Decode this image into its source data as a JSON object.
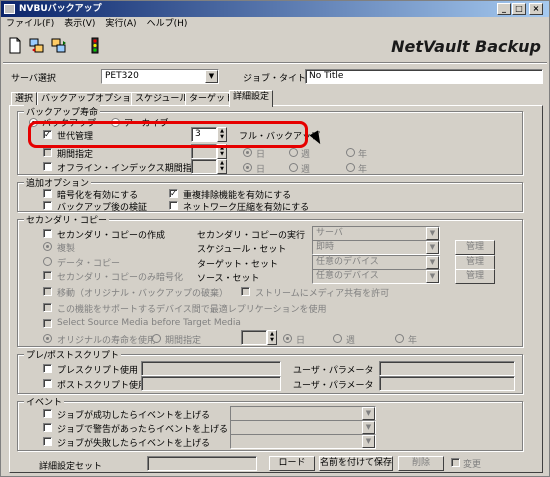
{
  "window": {
    "title": "NVBUバックアップ",
    "min": "_",
    "max": "□",
    "close": "×"
  },
  "menu": [
    "ファイル(F)",
    "表示(V)",
    "実行(A)",
    "ヘルプ(H)"
  ],
  "brand": "NetVault Backup",
  "server": {
    "label": "サーバ選択",
    "value": "PET320"
  },
  "job": {
    "label": "ジョブ・タイトル",
    "value": "No Title"
  },
  "tabs": [
    "選択",
    "バックアップオプション",
    "スケジュール",
    "ターゲット",
    "詳細設定"
  ],
  "retention": {
    "title": "バックアップ寿命",
    "radio_backup": "バックアップ",
    "radio_archive": "アーカイブ",
    "generation_label": "世代管理",
    "generation_value": "3",
    "generation_unit": "フル・バックアップ",
    "period_label": "期間指定",
    "offline_label": "オフライン・インデックス期間指定",
    "unit_day": "日",
    "unit_week": "週",
    "unit_year": "年"
  },
  "extra": {
    "title": "追加オプション",
    "encrypt": "暗号化を有効にする",
    "verify": "バックアップ後の検証",
    "dedup": "重複排除機能を有効にする",
    "compress": "ネットワーク圧縮を有効にする"
  },
  "secondary": {
    "title": "セカンダリ・コピー",
    "create": "セカンダリ・コピーの作成",
    "duplicate": "複製",
    "datacopy": "データ・コピー",
    "encrypt_only": "セカンダリ・コピーのみ暗号化",
    "migrate": "移動（オリジナル・バックアップの破棄）",
    "replicate": "この機能をサポートするデバイス間で最適レプリケーションを使用",
    "select_source": "Select Source Media before Target Media",
    "use_original": "オリジナルの寿命を使用",
    "use_period": "期間指定",
    "exec_label": "セカンダリ・コピーの実行",
    "exec_value": "サーバ",
    "schedule_label": "スケジュール・セット",
    "schedule_value": "即時",
    "target_label": "ターゲット・セット",
    "target_value": "任意のデバイス",
    "source_label": "ソース・セット",
    "source_value": "任意のデバイス",
    "stream": "ストリームにメディア共有を許可",
    "manage": "管理",
    "unit_day": "日",
    "unit_week": "週",
    "unit_year": "年"
  },
  "scripts": {
    "title": "プレ/ポストスクリプト",
    "pre": "プレスクリプト使用",
    "post": "ポストスクリプト使用",
    "param": "ユーザ・パラメータ"
  },
  "events": {
    "title": "イベント",
    "success": "ジョブが成功したらイベントを上げる",
    "warning": "ジョブで警告があったらイベントを上げる",
    "failure": "ジョブが失敗したらイベントを上げる"
  },
  "footer": {
    "set_label": "詳細設定セット",
    "load": "ロード",
    "save": "名前を付けて保存",
    "delete": "削除",
    "change": "変更"
  }
}
